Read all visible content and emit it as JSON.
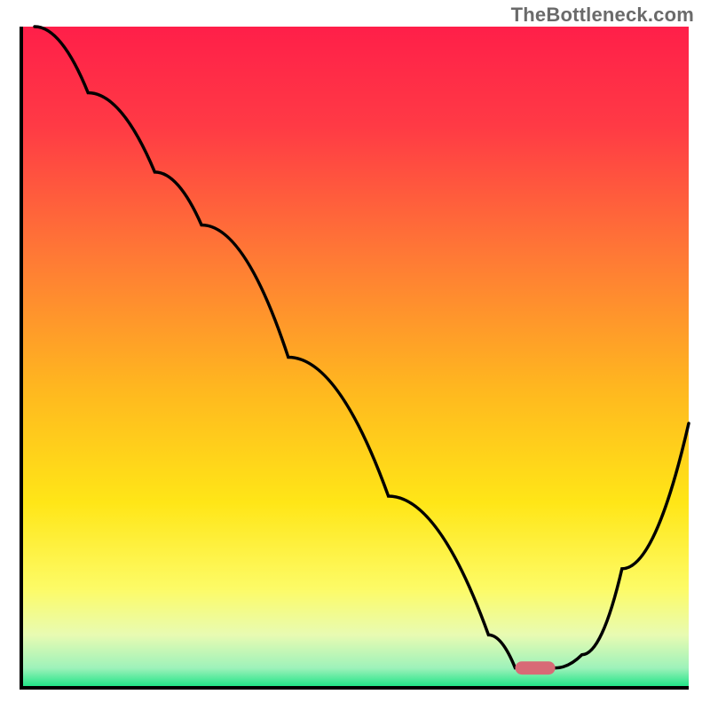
{
  "watermark": "TheBottleneck.com",
  "chart_data": {
    "type": "line",
    "title": "",
    "xlabel": "",
    "ylabel": "",
    "xlim": [
      0,
      100
    ],
    "ylim": [
      0,
      100
    ],
    "series": [
      {
        "name": "bottleneck-curve",
        "x": [
          2,
          10,
          20,
          27,
          40,
          55,
          70,
          74,
          80,
          84,
          90,
          100
        ],
        "values": [
          100,
          90,
          78,
          70,
          50,
          29,
          8,
          3,
          3,
          5,
          18,
          40
        ]
      }
    ],
    "marker": {
      "name": "optimal-marker",
      "x": 77,
      "y": 3,
      "width": 6,
      "height": 2,
      "color": "#d86a76"
    },
    "gradient_stops": [
      {
        "offset": 0.0,
        "color": "#ff1f49"
      },
      {
        "offset": 0.15,
        "color": "#ff3a45"
      },
      {
        "offset": 0.35,
        "color": "#ff7a35"
      },
      {
        "offset": 0.55,
        "color": "#ffb81f"
      },
      {
        "offset": 0.72,
        "color": "#ffe617"
      },
      {
        "offset": 0.85,
        "color": "#fdfb66"
      },
      {
        "offset": 0.92,
        "color": "#e8fbb2"
      },
      {
        "offset": 0.97,
        "color": "#9ef2ba"
      },
      {
        "offset": 1.0,
        "color": "#17e383"
      }
    ]
  }
}
